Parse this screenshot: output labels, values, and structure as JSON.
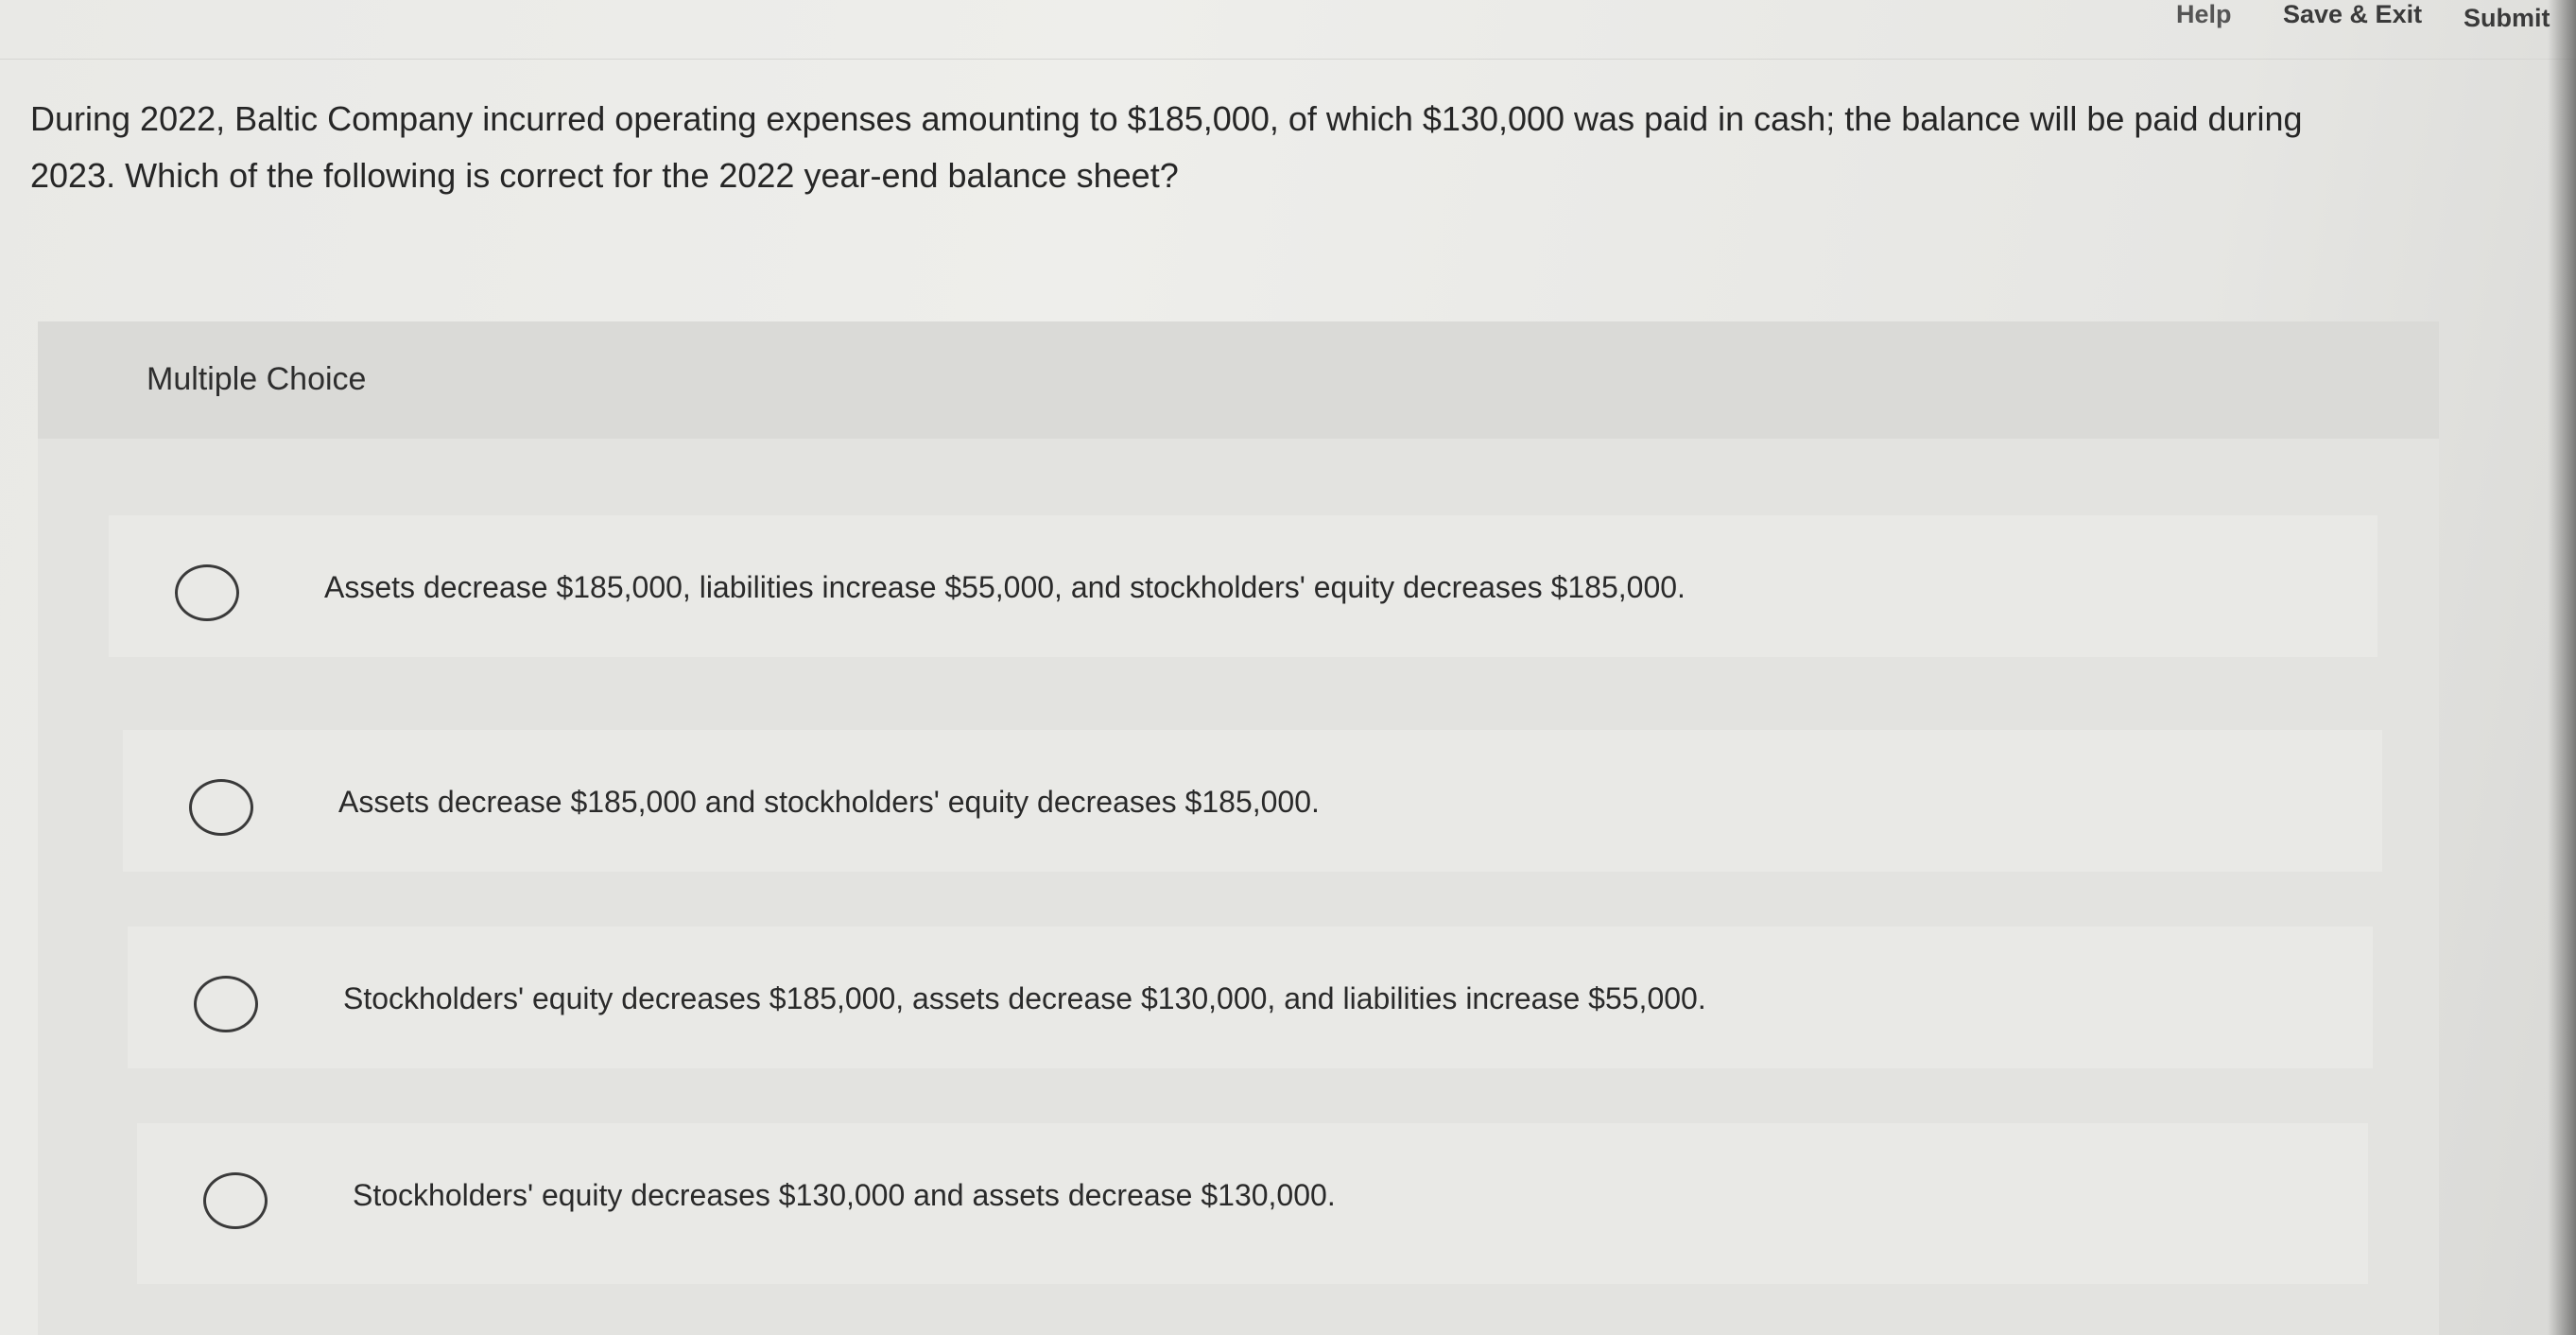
{
  "header": {
    "help_label": "Help",
    "save_exit_label": "Save & Exit",
    "submit_label": "Submit"
  },
  "question": {
    "text": "During 2022, Baltic Company incurred operating expenses amounting to $185,000, of which $130,000 was paid in cash; the balance will be paid during 2023. Which of the following is correct for the 2022 year-end balance sheet?"
  },
  "multiple_choice": {
    "title": "Multiple Choice",
    "choices": [
      {
        "label": "Assets decrease $185,000, liabilities increase $55,000, and stockholders' equity decreases $185,000."
      },
      {
        "label": "Assets decrease $185,000 and stockholders' equity decreases $185,000."
      },
      {
        "label": "Stockholders' equity decreases $185,000, assets decrease $130,000, and liabilities increase $55,000."
      },
      {
        "label": "Stockholders' equity decreases $130,000 and assets decrease $130,000."
      }
    ]
  }
}
